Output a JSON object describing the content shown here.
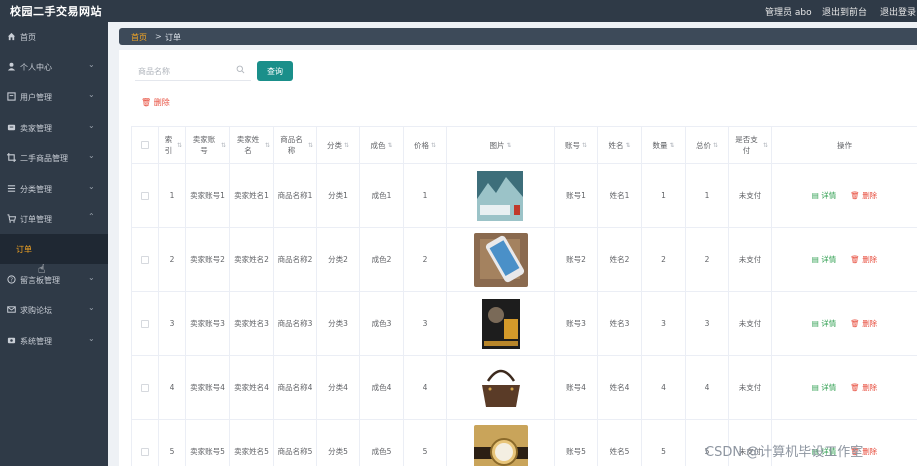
{
  "header": {
    "site_title": "校园二手交易网站",
    "admin_label": "管理员 abo",
    "backend_link": "退出到前台",
    "logout_link": "退出登录"
  },
  "sidebar": {
    "items": [
      {
        "label": "首页",
        "icon": "home-icon"
      },
      {
        "label": "个人中心",
        "icon": "user-icon"
      },
      {
        "label": "用户管理",
        "icon": "users-icon"
      },
      {
        "label": "卖家管理",
        "icon": "store-icon"
      },
      {
        "label": "二手商品管理",
        "icon": "crop-icon"
      },
      {
        "label": "分类管理",
        "icon": "list-icon"
      },
      {
        "label": "订单管理",
        "icon": "cart-icon"
      },
      {
        "label": "留言板管理",
        "icon": "message-icon"
      },
      {
        "label": "求购论坛",
        "icon": "mail-icon"
      },
      {
        "label": "系统管理",
        "icon": "settings-icon"
      }
    ],
    "submenu_active": "订单"
  },
  "breadcrumb": {
    "home": "首页",
    "separator": ">",
    "current": "订单"
  },
  "search": {
    "placeholder": "商品名称",
    "button": "查询"
  },
  "toolbar": {
    "delete_label": "删除"
  },
  "table": {
    "headers": [
      "索引",
      "卖家账号",
      "卖家姓名",
      "商品名称",
      "分类",
      "成色",
      "价格",
      "图片",
      "账号",
      "姓名",
      "数量",
      "总价",
      "是否支付",
      "操作"
    ],
    "rows": [
      {
        "idx": "1",
        "seller_account": "卖家账号1",
        "seller_name": "卖家姓名1",
        "product": "商品名称1",
        "category": "分类1",
        "condition": "成色1",
        "price": "1",
        "account": "账号1",
        "name": "姓名1",
        "qty": "1",
        "total": "1",
        "paid": "未支付",
        "image": "book"
      },
      {
        "idx": "2",
        "seller_account": "卖家账号2",
        "seller_name": "卖家姓名2",
        "product": "商品名称2",
        "category": "分类2",
        "condition": "成色2",
        "price": "2",
        "account": "账号2",
        "name": "姓名2",
        "qty": "2",
        "total": "2",
        "paid": "未支付",
        "image": "phone"
      },
      {
        "idx": "3",
        "seller_account": "卖家账号3",
        "seller_name": "卖家姓名3",
        "product": "商品名称3",
        "category": "分类3",
        "condition": "成色3",
        "price": "3",
        "account": "账号3",
        "name": "姓名3",
        "qty": "3",
        "total": "3",
        "paid": "未支付",
        "image": "biography"
      },
      {
        "idx": "4",
        "seller_account": "卖家账号4",
        "seller_name": "卖家姓名4",
        "product": "商品名称4",
        "category": "分类4",
        "condition": "成色4",
        "price": "4",
        "account": "账号4",
        "name": "姓名4",
        "qty": "4",
        "total": "4",
        "paid": "未支付",
        "image": "handbag"
      },
      {
        "idx": "5",
        "seller_account": "卖家账号5",
        "seller_name": "卖家姓名5",
        "product": "商品名称5",
        "category": "分类5",
        "condition": "成色5",
        "price": "5",
        "account": "账号5",
        "name": "姓名5",
        "qty": "5",
        "total": "5",
        "paid": "未支付",
        "image": "watch"
      }
    ],
    "detail_label": "详情",
    "delete_label": "删除"
  },
  "watermark": "CSDN @计算机毕设工作室",
  "colors": {
    "sidebar_bg": "#2f3a47",
    "accent": "#f5a623",
    "primary_button": "#1a8f8a",
    "danger": "#e74c3c",
    "success": "#2e9e4f"
  }
}
